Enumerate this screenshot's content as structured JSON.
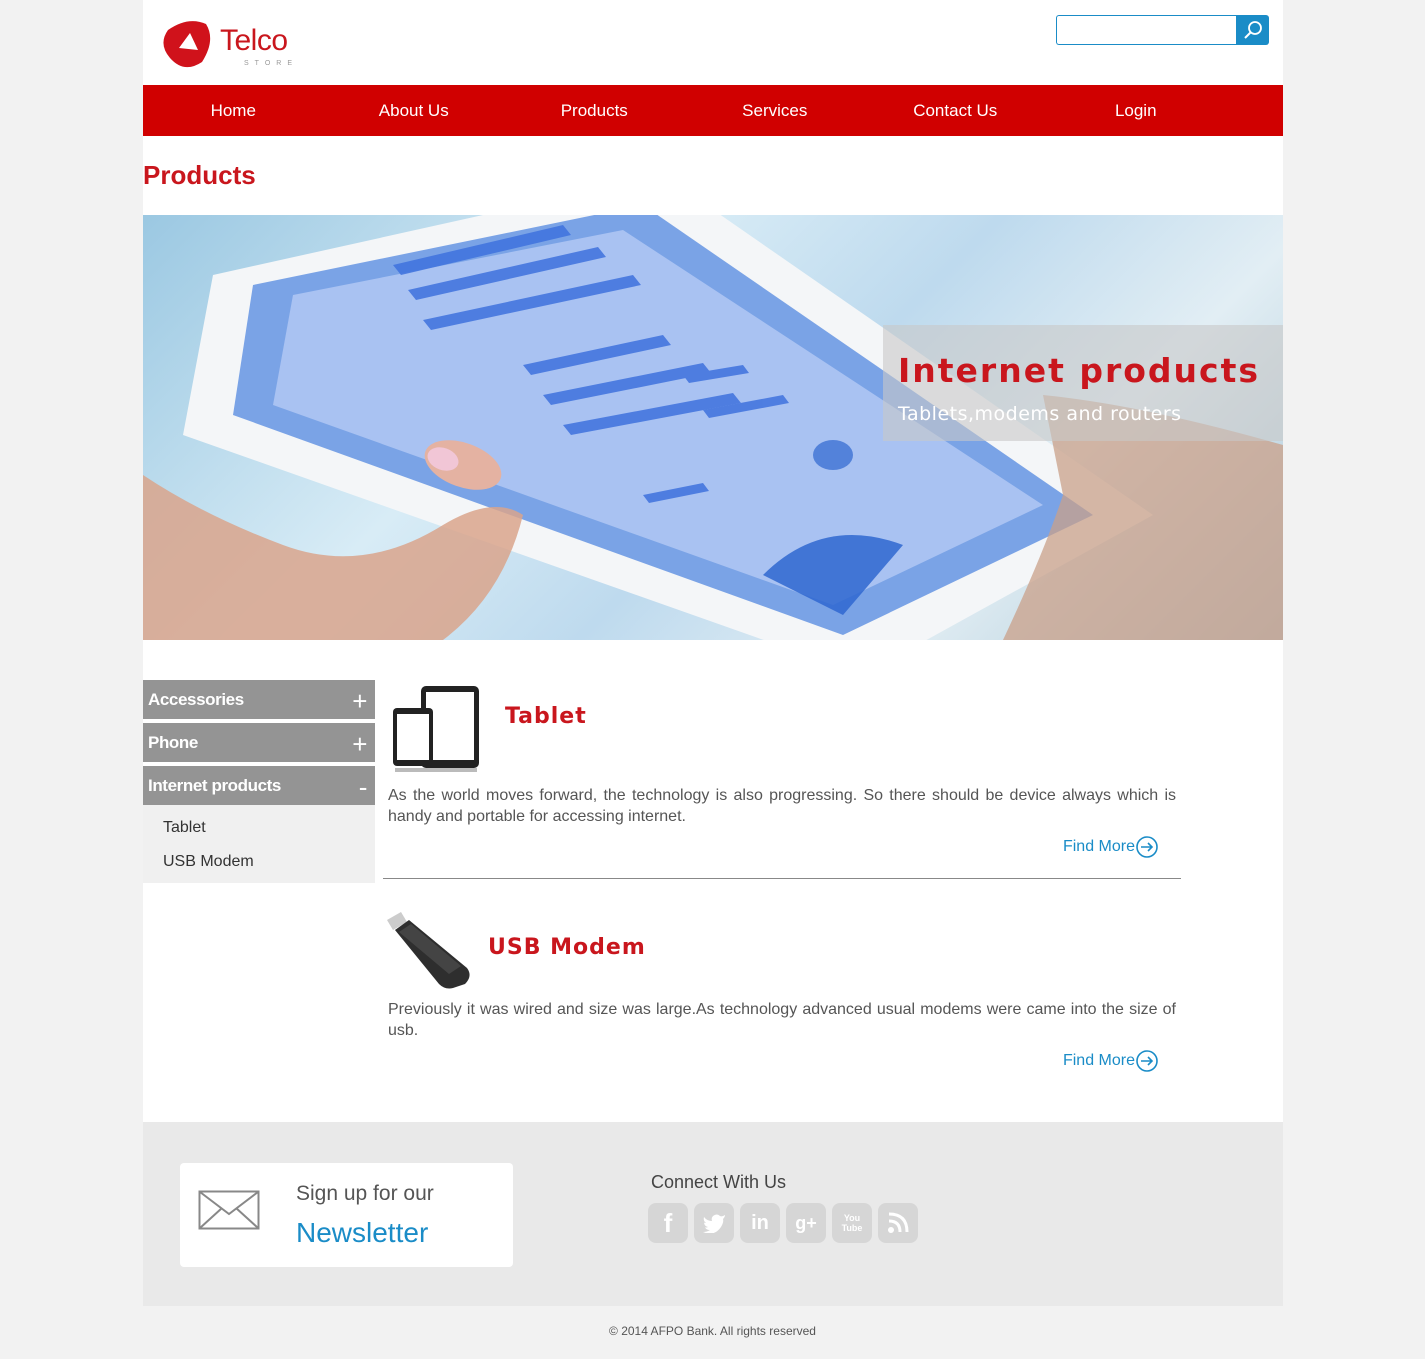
{
  "brand": {
    "name": "Telco",
    "tagline": "STORE",
    "accent": "#c9161d",
    "link_color": "#1a8cc7"
  },
  "search": {
    "placeholder": ""
  },
  "nav": {
    "items": [
      "Home",
      "About Us",
      "Products",
      "Services",
      "Contact Us",
      "Login"
    ]
  },
  "page_title": "Products",
  "hero": {
    "title": "Internet products",
    "subtitle": "Tablets,modems and routers"
  },
  "sidebar": {
    "categories": [
      {
        "label": "Accessories",
        "sign": "+"
      },
      {
        "label": "Phone",
        "sign": "+"
      },
      {
        "label": "Internet products",
        "sign": "-",
        "items": [
          "Tablet",
          "USB Modem"
        ]
      }
    ]
  },
  "products": [
    {
      "name": "Tablet",
      "icon": "tablet-icon",
      "description": "As the world moves forward, the technology is also progressing. So there should be device always which is handy and portable for accessing internet.",
      "link": "Find More"
    },
    {
      "name": "USB Modem",
      "icon": "usb-modem-icon",
      "description": "Previously it was wired and size was large.As technology advanced usual modems were came into the size of usb.",
      "link": "Find More"
    }
  ],
  "footer": {
    "newsletter_line1": "Sign up for our",
    "newsletter_line2": "Newsletter",
    "connect_title": "Connect With Us",
    "socials": [
      "facebook-icon",
      "twitter-icon",
      "linkedin-icon",
      "google-plus-icon",
      "youtube-icon",
      "rss-icon"
    ],
    "copyright": "© 2014 AFPO Bank. All rights reserved"
  }
}
